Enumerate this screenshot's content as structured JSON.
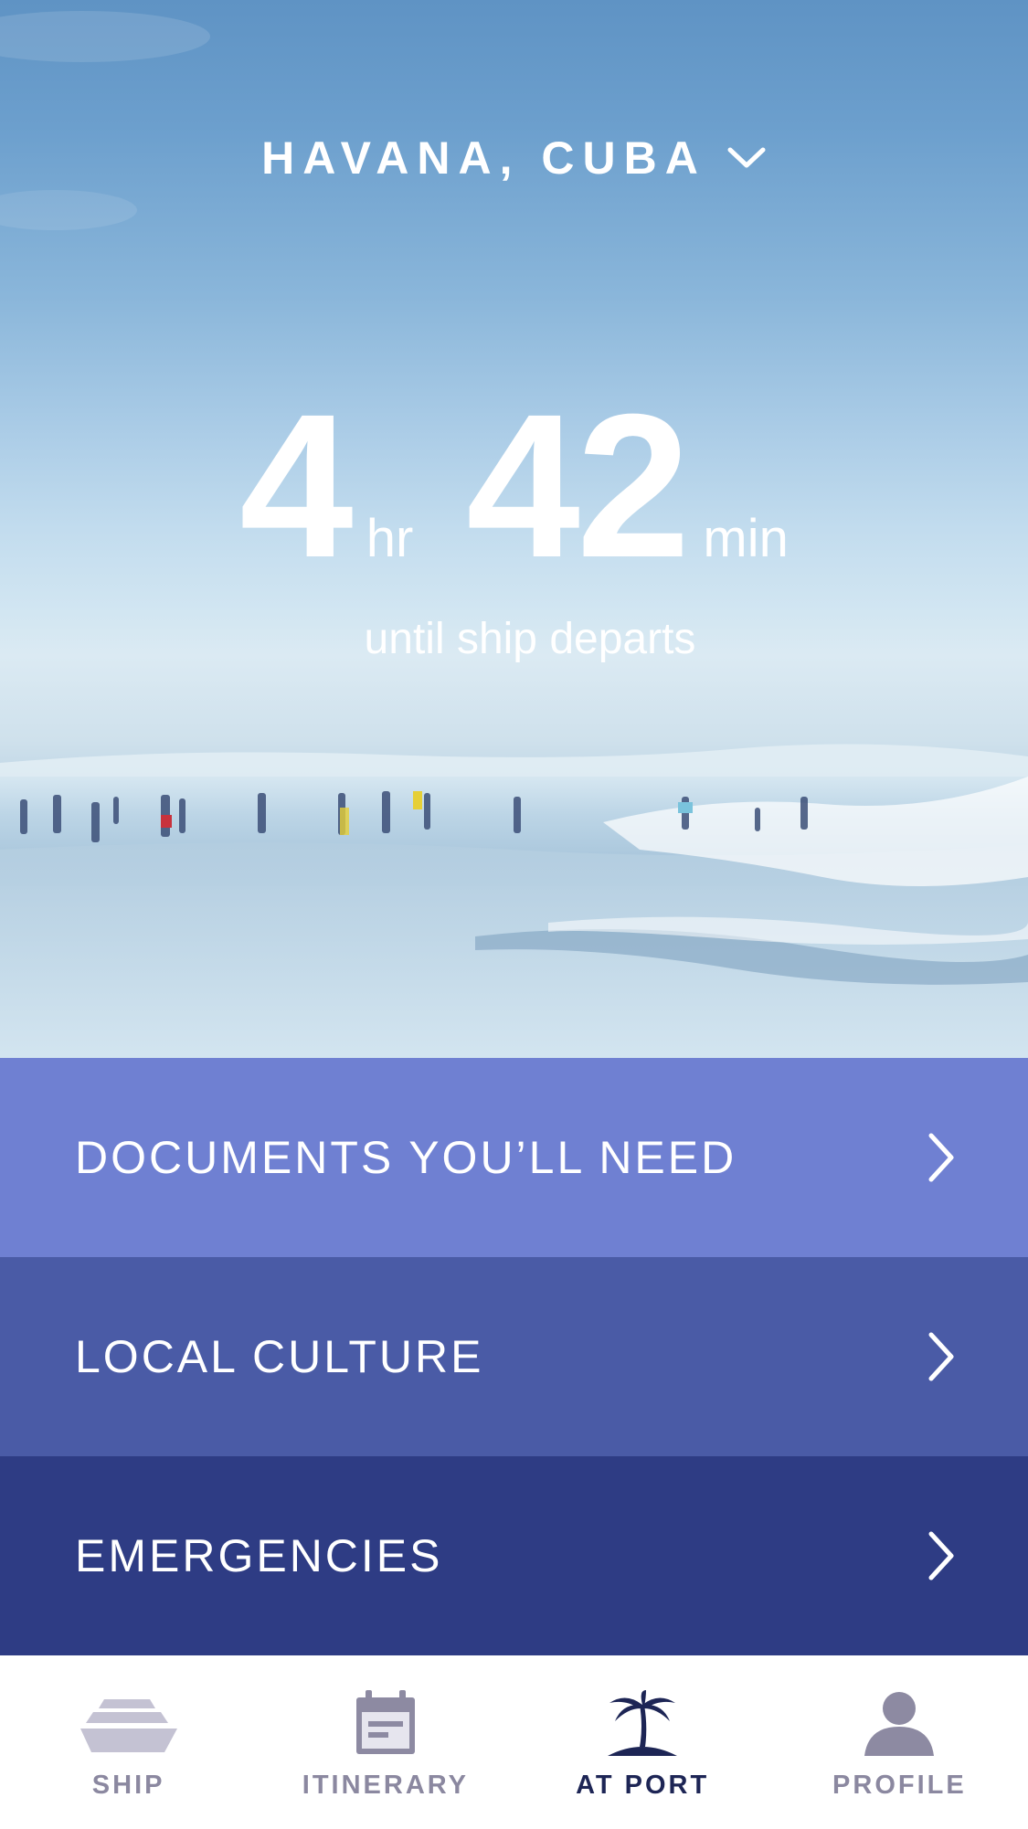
{
  "header": {
    "location": "HAVANA, CUBA",
    "dropdown_icon": "chevron-down-icon"
  },
  "countdown": {
    "hours": "4",
    "hours_unit": "hr",
    "minutes": "42",
    "minutes_unit": "min",
    "caption": "until ship departs"
  },
  "menu": {
    "items": [
      {
        "label": "DOCUMENTS YOU’LL NEED",
        "icon": "chevron-right-icon",
        "color": "#6f80d2"
      },
      {
        "label": "LOCAL CULTURE",
        "icon": "chevron-right-icon",
        "color": "#4a5ba6"
      },
      {
        "label": "EMERGENCIES",
        "icon": "chevron-right-icon",
        "color": "#2e3c84"
      }
    ]
  },
  "tabbar": {
    "tabs": [
      {
        "label": "SHIP",
        "icon": "ship-icon",
        "active": false
      },
      {
        "label": "ITINERARY",
        "icon": "calendar-icon",
        "active": false
      },
      {
        "label": "AT PORT",
        "icon": "palm-tree-icon",
        "active": true
      },
      {
        "label": "PROFILE",
        "icon": "person-icon",
        "active": false
      }
    ],
    "active_color": "#1d2555",
    "inactive_color": "#8b88a0"
  }
}
